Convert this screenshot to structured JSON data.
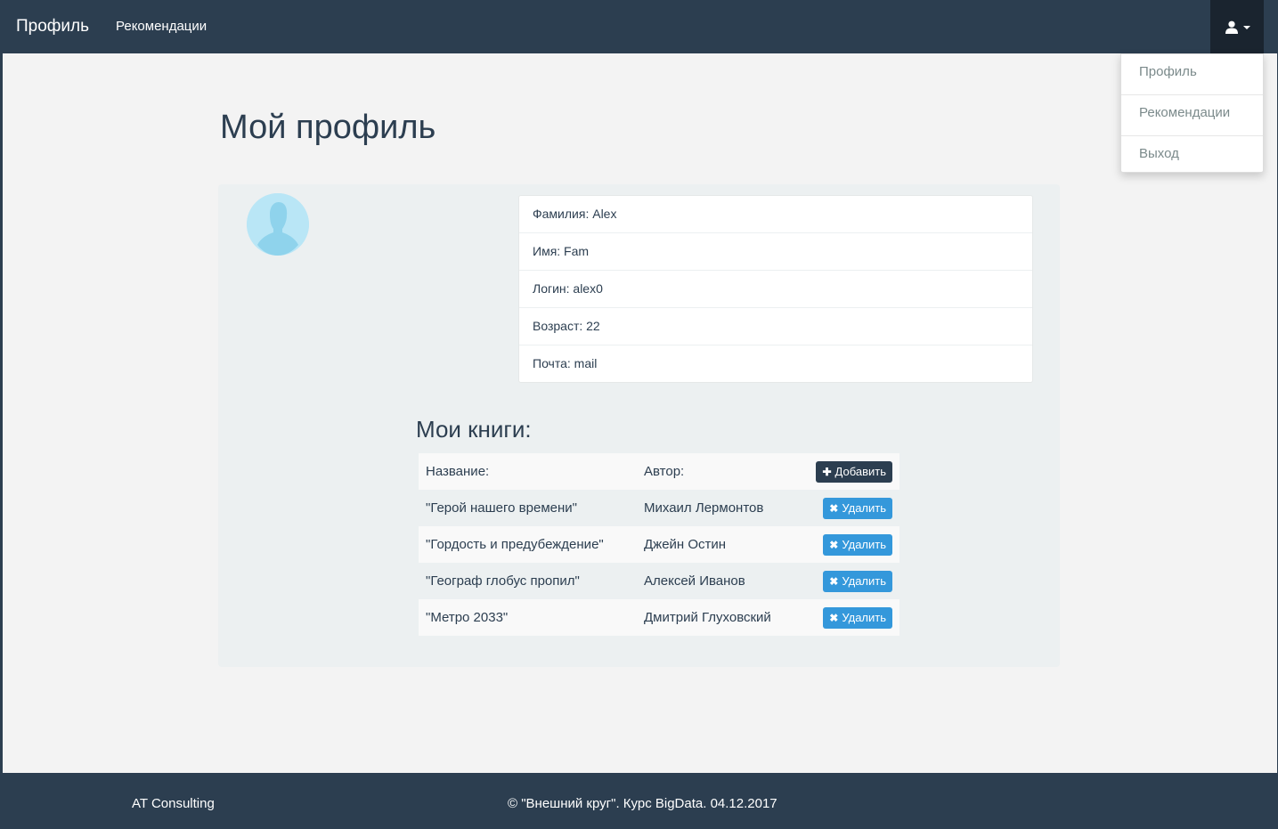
{
  "navbar": {
    "brand": "Профиль",
    "links": [
      "Рекомендации"
    ],
    "user_icon": "user-icon"
  },
  "dropdown": {
    "items": [
      "Профиль",
      "Рекомендации",
      "Выход"
    ]
  },
  "page": {
    "title": "Мой профиль"
  },
  "profile": {
    "fields": [
      "Фамилия: Alex",
      "Имя: Fam",
      "Логин: alex0",
      "Возраст: 22",
      "Почта: mail"
    ]
  },
  "books": {
    "title": "Мои книги:",
    "header": {
      "name": "Название:",
      "author": "Автор:",
      "add_label": "Добавить"
    },
    "delete_label": "Удалить",
    "rows": [
      {
        "name": "\"Герой нашего времени\"",
        "author": "Михаил Лермонтов"
      },
      {
        "name": "\"Гордость и предубеждение\"",
        "author": "Джейн Остин"
      },
      {
        "name": "\"Географ глобус пропил\"",
        "author": "Алексей Иванов"
      },
      {
        "name": "\"Метро 2033\"",
        "author": "Дмитрий Глуховский"
      }
    ]
  },
  "footer": {
    "left": "AT Consulting",
    "center": "© \"Внешний круг\". Курс BigData. 04.12.2017"
  },
  "colors": {
    "primary": "#2c3e50",
    "info": "#3498db",
    "background": "#f3f3f3",
    "well": "#ecf0f1"
  }
}
